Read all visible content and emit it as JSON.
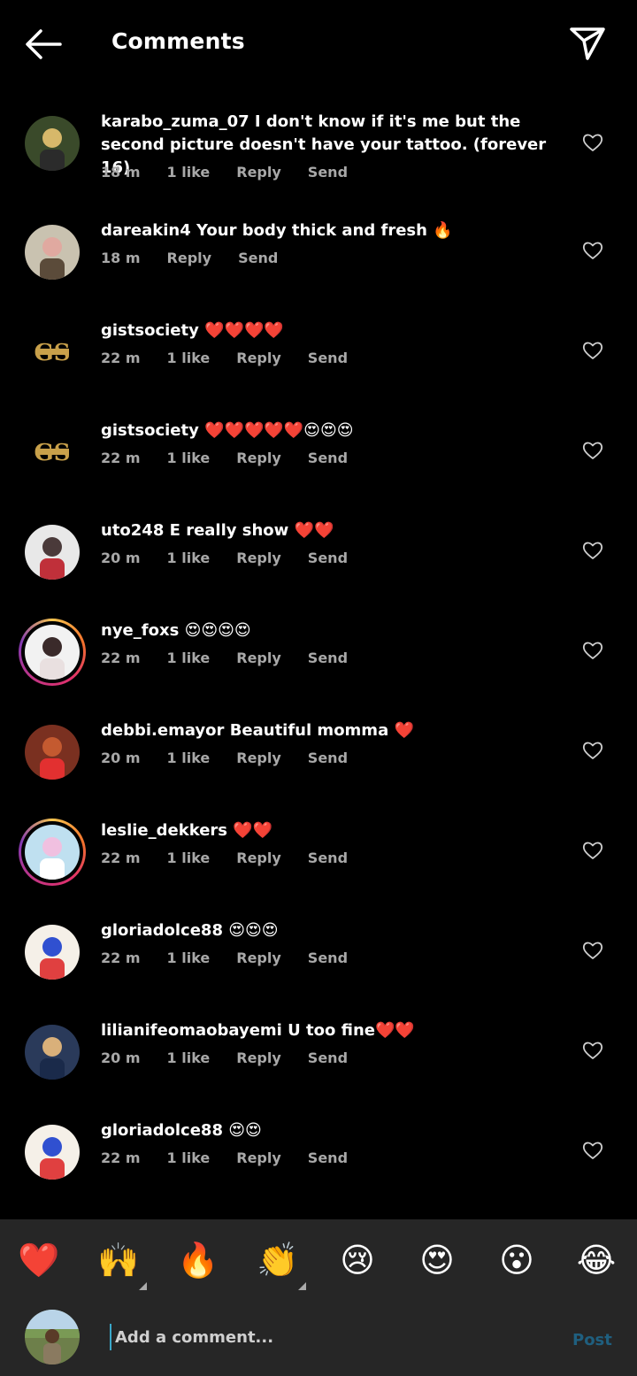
{
  "header": {
    "title": "Comments",
    "back_icon": "arrow-left-icon",
    "send_icon": "paper-plane-icon"
  },
  "comments": [
    {
      "user": "karabo_zuma_07",
      "text": "I don't know if it's me but the second picture doesn't have your tattoo. (forever 16)",
      "time": "18 m",
      "likes": "1 like",
      "reply": "Reply",
      "send": "Send",
      "story_ring": false
    },
    {
      "user": "dareakin4",
      "text": "Your body thick and fresh 🔥",
      "time": "18 m",
      "likes": "",
      "reply": "Reply",
      "send": "Send",
      "story_ring": false
    },
    {
      "user": "gistsociety",
      "text": "❤️❤️❤️❤️",
      "time": "22 m",
      "likes": "1 like",
      "reply": "Reply",
      "send": "Send",
      "story_ring": false
    },
    {
      "user": "gistsociety",
      "text": "❤️❤️❤️❤️❤️😍😍😍",
      "time": "22 m",
      "likes": "1 like",
      "reply": "Reply",
      "send": "Send",
      "story_ring": false
    },
    {
      "user": "uto248",
      "text": "E really show ❤️❤️",
      "time": "20 m",
      "likes": "1 like",
      "reply": "Reply",
      "send": "Send",
      "story_ring": false
    },
    {
      "user": "nye_foxs",
      "text": "😍😍😍😍",
      "time": "22 m",
      "likes": "1 like",
      "reply": "Reply",
      "send": "Send",
      "story_ring": true
    },
    {
      "user": "debbi.emayor",
      "text": "Beautiful momma ❤️",
      "time": "20 m",
      "likes": "1 like",
      "reply": "Reply",
      "send": "Send",
      "story_ring": false
    },
    {
      "user": "leslie_dekkers",
      "text": "❤️❤️",
      "time": "22 m",
      "likes": "1 like",
      "reply": "Reply",
      "send": "Send",
      "story_ring": true
    },
    {
      "user": "gloriadolce88",
      "text": "😍😍😍",
      "time": "22 m",
      "likes": "1 like",
      "reply": "Reply",
      "send": "Send",
      "story_ring": false
    },
    {
      "user": "lilianifeomaobayemi",
      "text": "U too fine❤️❤️",
      "time": "20 m",
      "likes": "1 like",
      "reply": "Reply",
      "send": "Send",
      "story_ring": false
    },
    {
      "user": "gloriadolce88",
      "text": "😍😍",
      "time": "22 m",
      "likes": "1 like",
      "reply": "Reply",
      "send": "Send",
      "story_ring": false
    }
  ],
  "avatar_badge_text": "GS",
  "quick_reactions": [
    "❤️",
    "🙌",
    "🔥",
    "👏",
    "😢",
    "😍",
    "😮",
    "😂"
  ],
  "compose": {
    "placeholder": "Add a comment...",
    "post_label": "Post"
  },
  "colors": {
    "background": "#000000",
    "bottom_bar": "#262626",
    "meta_text": "#a8a8a8",
    "post_disabled": "#1f5f7f"
  }
}
